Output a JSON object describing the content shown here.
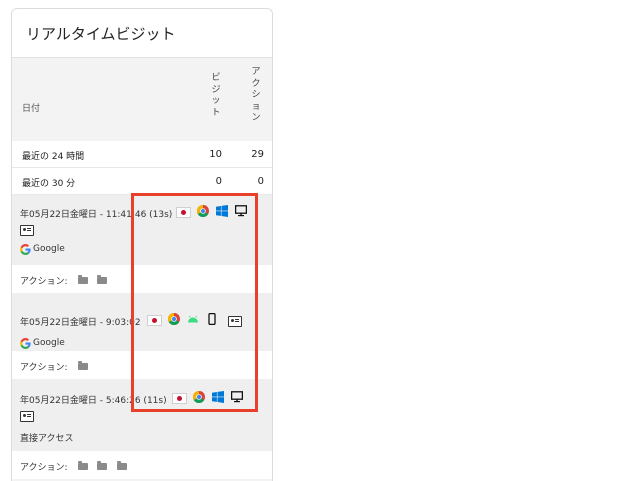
{
  "widget": {
    "title": "リアルタイムビジット",
    "header": {
      "date_col": "日付",
      "visits_col": "ビジット",
      "actions_col": "アクション"
    },
    "summary": [
      {
        "label": "最近の 24 時間",
        "visits": "10",
        "actions": "29"
      },
      {
        "label": "最近の 30 分",
        "visits": "0",
        "actions": "0"
      }
    ],
    "visits": [
      {
        "datetime": "年05月22日金曜日 - 11:41:46 (13s)",
        "referrer": "Google",
        "actions_label": "アクション:"
      },
      {
        "datetime": "年05月22日金曜日 - 9:03:02",
        "referrer": "Google",
        "actions_label": "アクション:"
      },
      {
        "datetime": "年05月22日金曜日 - 5:46:26 (11s)",
        "referrer": "直接アクセス",
        "actions_label": "アクション:"
      }
    ]
  },
  "icons": {
    "flag": "japan-flag-icon",
    "browser": "chrome-icon",
    "os_windows": "windows-icon",
    "os_android": "android-icon",
    "desktop": "desktop-icon",
    "mobile": "smartphone-icon",
    "visitor": "visitor-profile-icon",
    "search": "google-icon",
    "action": "folder-icon"
  },
  "colors": {
    "highlight": "#e8402a",
    "chrome_red": "#db4437",
    "chrome_yellow": "#f4b400",
    "chrome_green": "#0f9d58",
    "chrome_blue": "#4285f4",
    "windows_blue": "#0078d7",
    "android_green": "#3ddc84"
  }
}
